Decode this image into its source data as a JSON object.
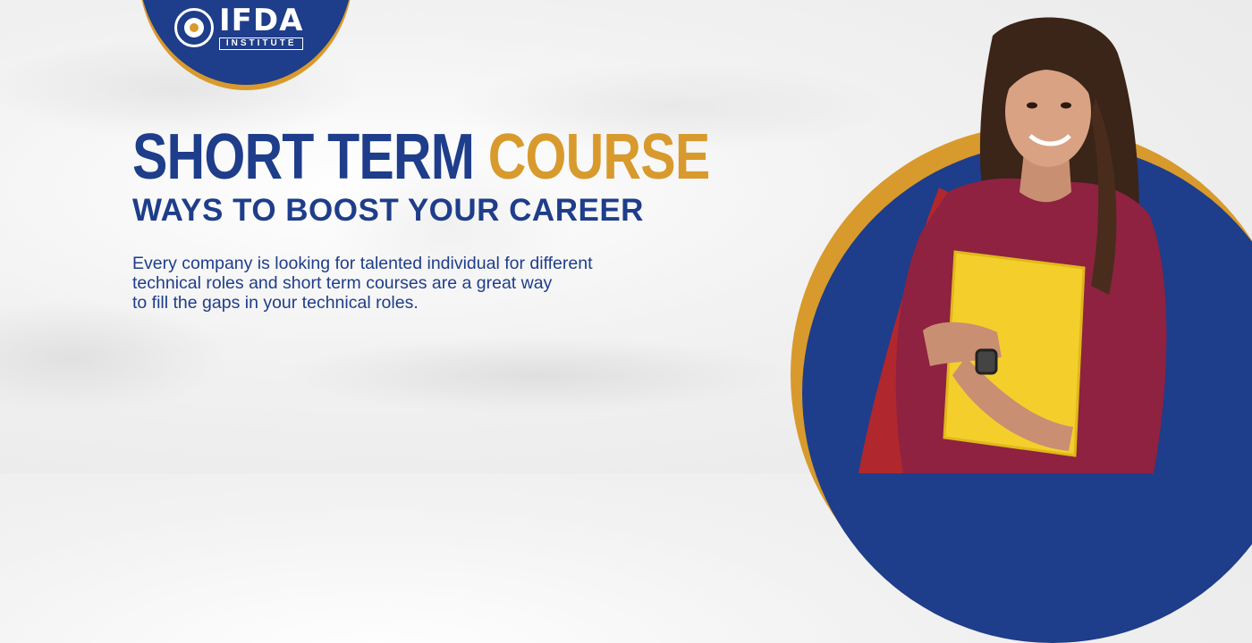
{
  "brand": {
    "name": "IFDA",
    "tagline": "INSTITUTE"
  },
  "hero": {
    "title_part1": "SHORT TERM",
    "title_part2": "COURSE",
    "subtitle": "WAYS TO BOOST YOUR CAREER",
    "body_lines": [
      "Every company is looking for talented individual for different",
      "technical roles and short term courses are a great way",
      "to fill the gaps in your technical roles."
    ]
  },
  "colors": {
    "navy": "#1e3d8a",
    "gold": "#d89a2c",
    "background": "#efefef"
  },
  "icons": {
    "logo_mark": "graduate-emblem-icon"
  }
}
